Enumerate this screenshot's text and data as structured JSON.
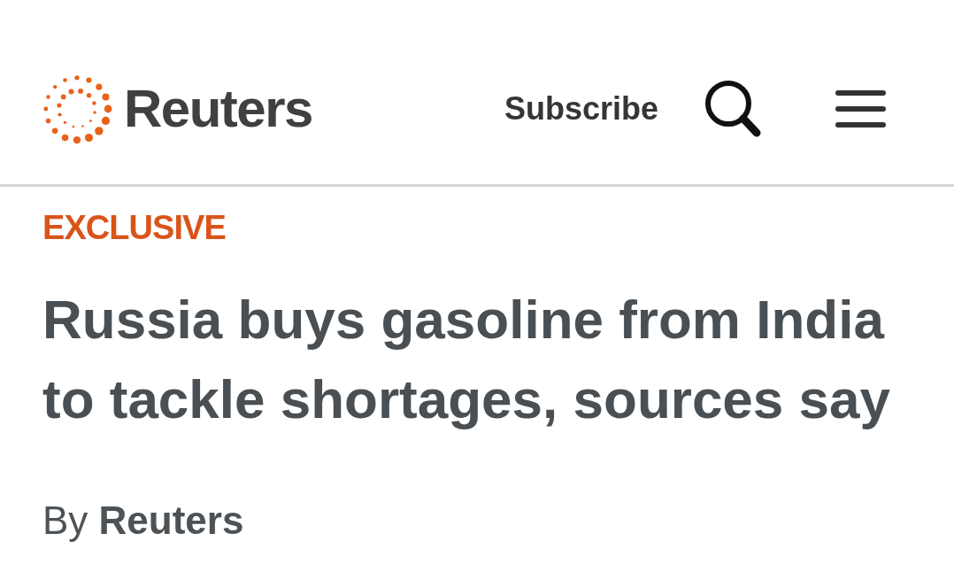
{
  "header": {
    "logo": {
      "wordmark": "Reuters"
    },
    "subscribe": {
      "label": "Subscribe"
    }
  },
  "article": {
    "label": "EXCLUSIVE",
    "headline": "Russia buys gasoline from India to tackle shortages, sources say",
    "byline": "By **Reuters**"
  }
}
